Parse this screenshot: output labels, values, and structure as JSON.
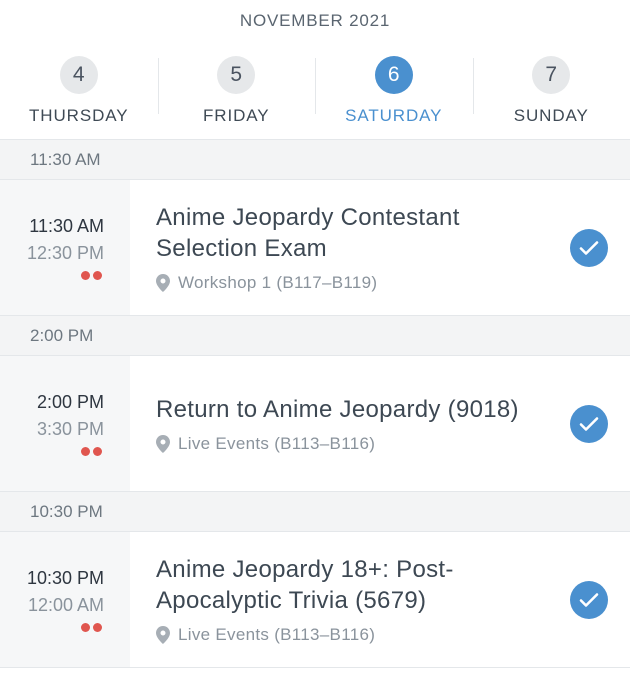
{
  "month": "NOVEMBER 2021",
  "days": [
    {
      "num": "4",
      "name": "THURSDAY"
    },
    {
      "num": "5",
      "name": "FRIDAY"
    },
    {
      "num": "6",
      "name": "SATURDAY"
    },
    {
      "num": "7",
      "name": "SUNDAY"
    }
  ],
  "colors": {
    "accent": "#4a90cf",
    "dot": "#e0564f",
    "section_bg": "#f3f4f5"
  },
  "slots": [
    {
      "header": "11:30 AM",
      "event": {
        "start": "11:30 AM",
        "end": "12:30 PM",
        "title": "Anime Jeopardy Contestant Selection Exam",
        "location": "Workshop 1 (B117–B119)"
      }
    },
    {
      "header": "2:00 PM",
      "event": {
        "start": "2:00 PM",
        "end": "3:30 PM",
        "title": "Return to Anime Jeopardy (9018)",
        "location": "Live Events (B113–B116)"
      }
    },
    {
      "header": "10:30 PM",
      "event": {
        "start": "10:30 PM",
        "end": "12:00 AM",
        "title": "Anime Jeopardy 18+: Post-Apocalyptic Trivia (5679)",
        "location": "Live Events (B113–B116)"
      }
    }
  ]
}
